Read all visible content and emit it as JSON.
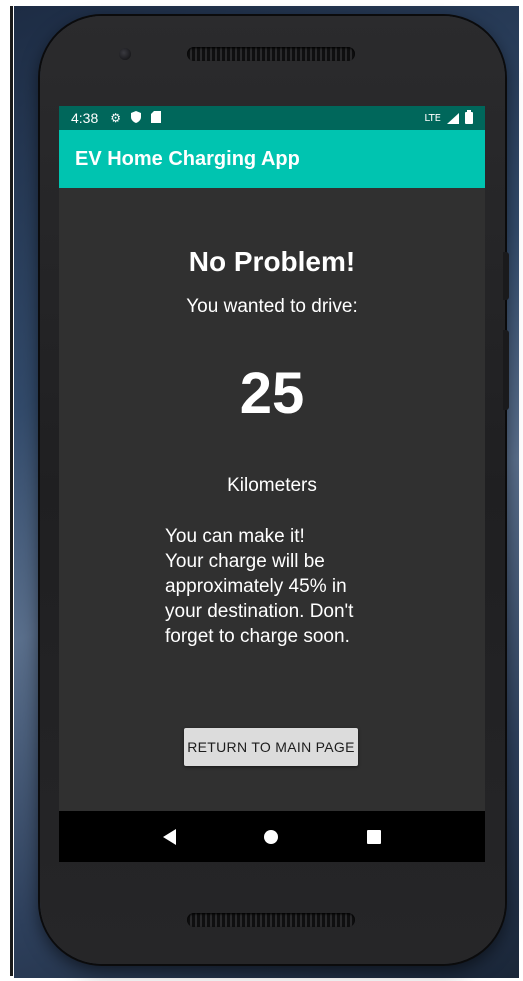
{
  "status_bar": {
    "time": "4:38",
    "icons": [
      "gear-icon",
      "shield-icon",
      "sd-card-icon"
    ],
    "network": "LTE",
    "background_color": "#00675b"
  },
  "app_bar": {
    "title": "EV Home Charging App",
    "color": "#00c4b0"
  },
  "main": {
    "headline": "No Problem!",
    "subline": "You wanted to drive:",
    "distance_value": "25",
    "distance_unit": "Kilometers",
    "message_lines": [
      "You can make it!",
      "Your charge will be",
      "approximately 45% in",
      "your destination. Don't",
      "forget to charge soon."
    ],
    "return_button_label": "RETURN TO MAIN PAGE",
    "background_color": "#303030"
  },
  "nav_bar": {
    "icons": [
      "back-icon",
      "home-icon",
      "recent-apps-icon"
    ]
  }
}
